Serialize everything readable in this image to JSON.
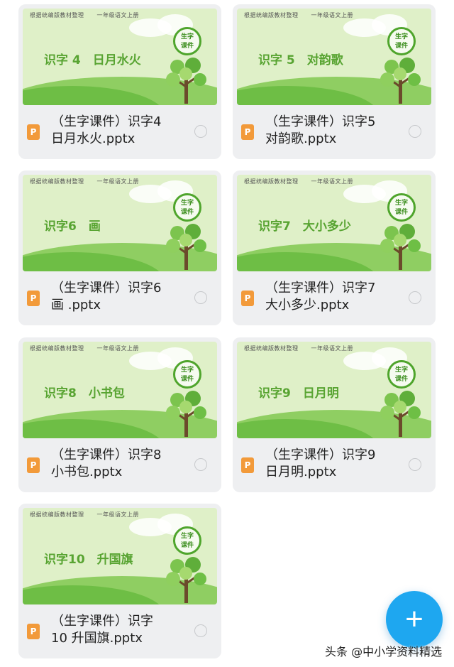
{
  "files": [
    {
      "thumb_header_left": "根据统编版教材整理",
      "thumb_header_right": "一年级语文上册",
      "thumb_title": "识字 4　日月水火",
      "badge_text": "生字\n课件",
      "name_line1": "（生字课件）识字4",
      "name_line2": "日月水火.pptx"
    },
    {
      "thumb_header_left": "根据统编版教材整理",
      "thumb_header_right": "一年级语文上册",
      "thumb_title": "识字 5　对韵歌",
      "badge_text": "生字\n课件",
      "name_line1": "（生字课件）识字5",
      "name_line2": "对韵歌.pptx"
    },
    {
      "thumb_header_left": "根据统编版教材整理",
      "thumb_header_right": "一年级语文上册",
      "thumb_title": "识字6　画",
      "badge_text": "生字\n课件",
      "name_line1": "（生字课件）识字6",
      "name_line2": "画 .pptx"
    },
    {
      "thumb_header_left": "根据统编版教材整理",
      "thumb_header_right": "一年级语文上册",
      "thumb_title": "识字7　大小多少",
      "badge_text": "生字\n课件",
      "name_line1": "（生字课件）识字7",
      "name_line2": "大小多少.pptx"
    },
    {
      "thumb_header_left": "根据统编版教材整理",
      "thumb_header_right": "一年级语文上册",
      "thumb_title": "识字8　小书包",
      "badge_text": "生字\n课件",
      "name_line1": "（生字课件）识字8",
      "name_line2": "小书包.pptx"
    },
    {
      "thumb_header_left": "根据统编版教材整理",
      "thumb_header_right": "一年级语文上册",
      "thumb_title": "识字9　日月明",
      "badge_text": "生字\n课件",
      "name_line1": "（生字课件）识字9",
      "name_line2": "日月明.pptx"
    },
    {
      "thumb_header_left": "根据统编版教材整理",
      "thumb_header_right": "一年级语文上册",
      "thumb_title": "识字10　升国旗",
      "badge_text": "生字\n课件",
      "name_line1": "（生字课件）识字",
      "name_line2": "10 升国旗.pptx"
    }
  ],
  "file_icon_letter": "P",
  "fab_label": "+",
  "watermark": "头条 @中小学资料精选",
  "colors": {
    "card_bg": "#eeeff1",
    "file_icon": "#f29a3a",
    "fab": "#1ea7f0",
    "thumb_title": "#58a432"
  },
  "icons": {
    "file_type": "powerpoint-file-icon",
    "select": "selection-circle-icon",
    "fab": "plus-icon"
  }
}
